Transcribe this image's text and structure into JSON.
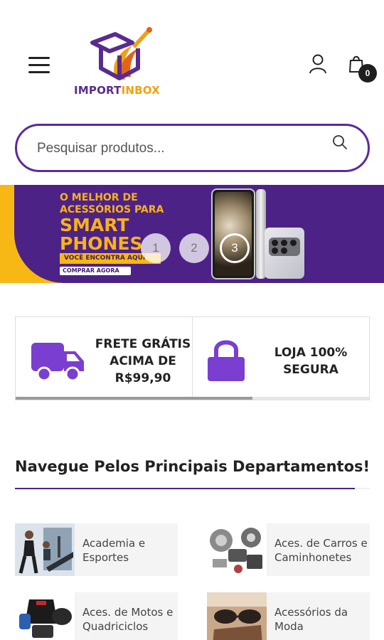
{
  "header": {
    "logo_text_a": "IMPORT",
    "logo_text_b": "INBOX",
    "cart_count": "0"
  },
  "search": {
    "placeholder": "Pesquisar produtos..."
  },
  "banner": {
    "line1": "O MELHOR DE ACESSÓRIOS PARA",
    "line2": "SMART PHONES",
    "tag": "VOCÊ ENCONTRA AQUI",
    "cta": "COMPRAR AGORA",
    "slides": [
      "1",
      "2",
      "3"
    ],
    "active_slide": 3
  },
  "features": {
    "items": [
      {
        "icon": "truck-icon",
        "text": "FRETE GRÁTIS ACIMA DE R$99,90"
      },
      {
        "icon": "lock-icon",
        "text": "LOJA 100% SEGURA"
      }
    ],
    "carousel_progress": 0.67
  },
  "departments": {
    "title": "Navegue Pelos Principais Departamentos!",
    "items": [
      {
        "label": "Academia e Esportes"
      },
      {
        "label": "Aces. de Carros e Caminhonetes"
      },
      {
        "label": "Aces. de Motos e Quadriciclos"
      },
      {
        "label": "Acessórios da Moda"
      }
    ]
  },
  "colors": {
    "brand_purple": "#4d2287",
    "brand_yellow": "#f7b815",
    "search_border": "#5b2b9a",
    "icon_purple": "#7a3fd0"
  }
}
